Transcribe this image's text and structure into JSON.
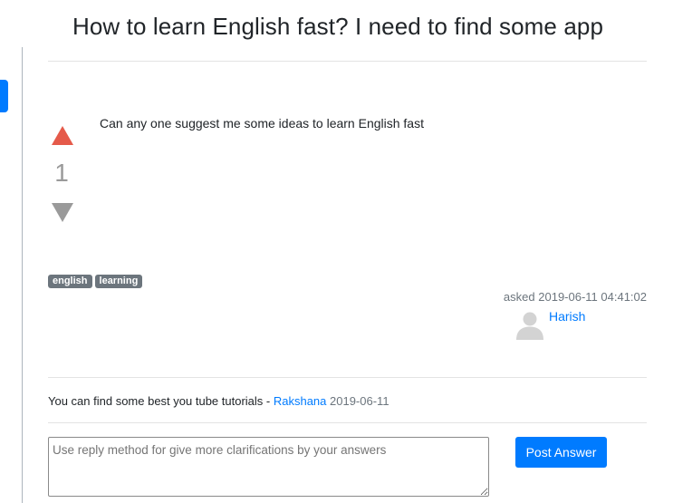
{
  "question": {
    "title": "How to learn English fast? I need to find some app",
    "body": "Can any one suggest me some ideas to learn English fast",
    "votes": "1",
    "tags": [
      "english",
      "learning"
    ],
    "asked_label": "asked",
    "asked_datetime": "2019-06-11 04:41:02",
    "author": "Harish"
  },
  "comment": {
    "text": "You can find some best you tube tutorials - ",
    "author": "Rakshana",
    "date": "2019-06-11"
  },
  "reply": {
    "placeholder": "Use reply method for give more clarifications by your answers",
    "value": "",
    "submit_label": "Post Answer"
  },
  "colors": {
    "accent": "#007bff",
    "upvote": "#e55a4a",
    "downvote": "#9a9a9a",
    "tag_bg": "#6c757d"
  },
  "icons": {
    "upvote": "triangle-up-icon",
    "downvote": "triangle-down-icon",
    "avatar": "user-silhouette-icon"
  }
}
